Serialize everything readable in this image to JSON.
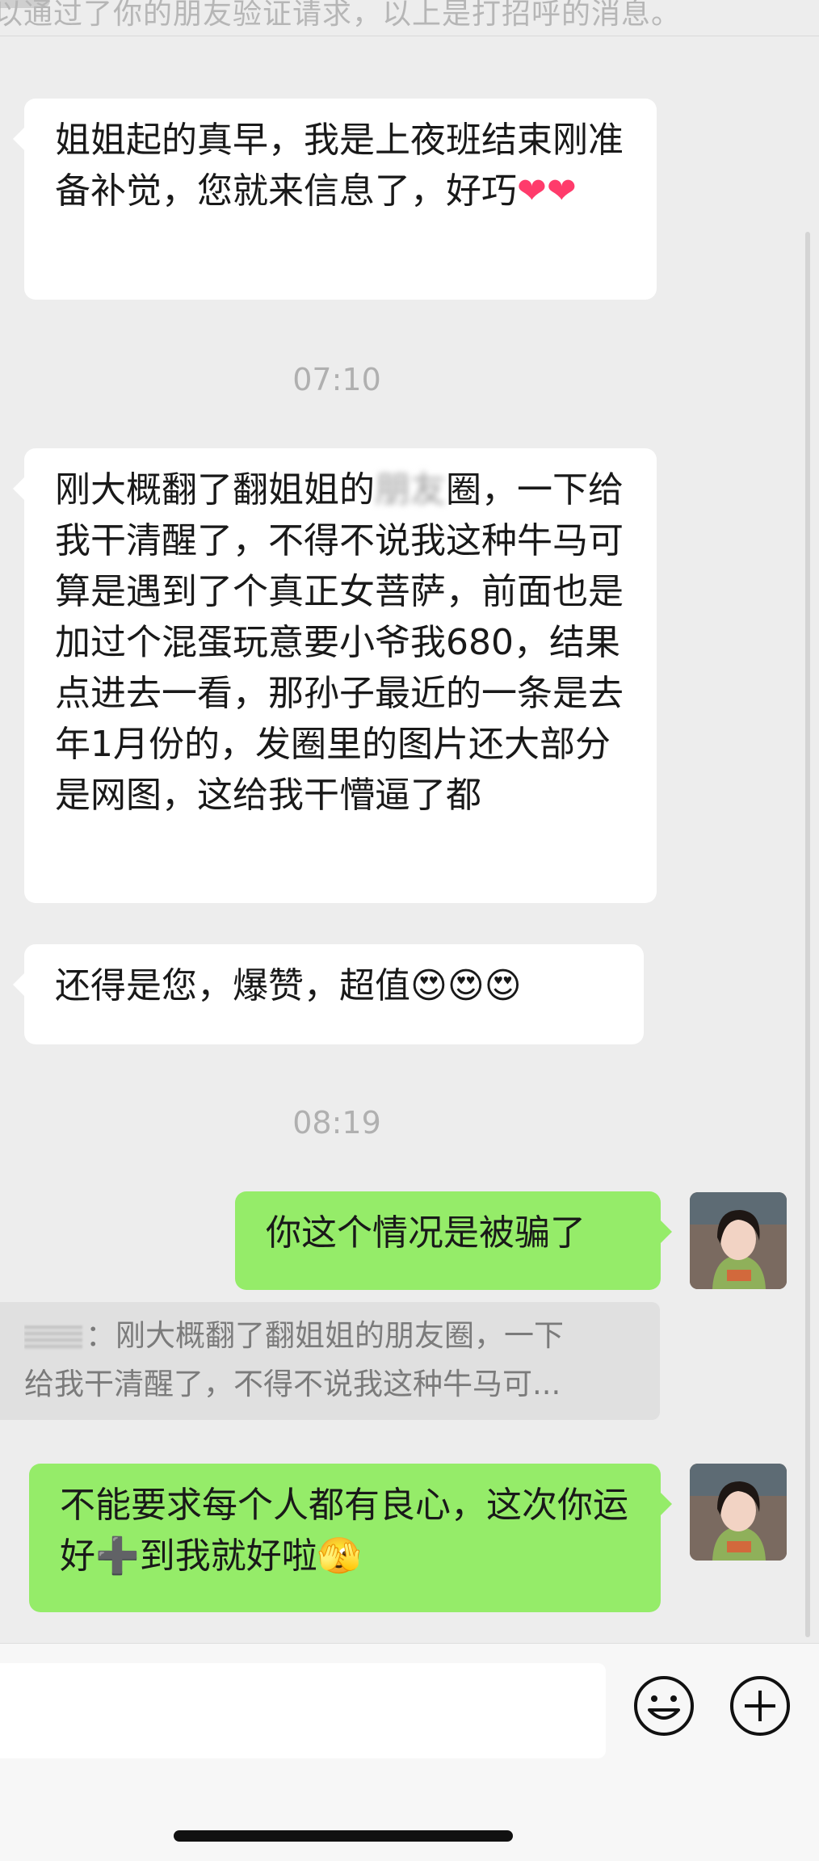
{
  "system_notice": "以通过了你的朋友验证请求，以上是打招呼的消息。",
  "messages": [
    {
      "id": "m1",
      "text": "姐姐起的真早，我是上夜班结束刚准备补觉，您就来信息了，好巧",
      "emoji": "❤❤"
    },
    {
      "id": "t1",
      "time": "07:10"
    },
    {
      "id": "m2",
      "text_before": "刚大概翻了翻姐姐的",
      "text_blurred": "朋友",
      "text_after": "圈，一下给我干清醒了，不得不说我这种牛马可算是遇到了个真正女菩萨，前面也是加过个混蛋玩意要小爷我680，结果点进去一看，那孙子最近的一条是去年1月份的，发圈里的图片还大部分是网图，这给我干懵逼了都"
    },
    {
      "id": "m3",
      "text": "还得是您，爆赞，超值",
      "emoji": "😍😍😍"
    },
    {
      "id": "t2",
      "time": "08:19"
    },
    {
      "id": "m4",
      "text": "你这个情况是被骗了"
    },
    {
      "id": "q1",
      "quote_line1": "：刚大概翻了翻姐姐的朋友圈，一下",
      "quote_line2": "给我干清醒了，不得不说我这种牛马可..."
    },
    {
      "id": "m5",
      "text": "不能要求每个人都有良心，这次你运好",
      "plus": "➕",
      "text_after": "到我就好啦",
      "emoji": "🫣"
    }
  ],
  "icons": {
    "emoji_button": "smiley-icon",
    "more_button": "plus-circle-icon"
  },
  "colors": {
    "background": "#ededed",
    "incoming_bubble": "#ffffff",
    "outgoing_bubble": "#95ec69",
    "input_bar": "#f7f7f7"
  }
}
